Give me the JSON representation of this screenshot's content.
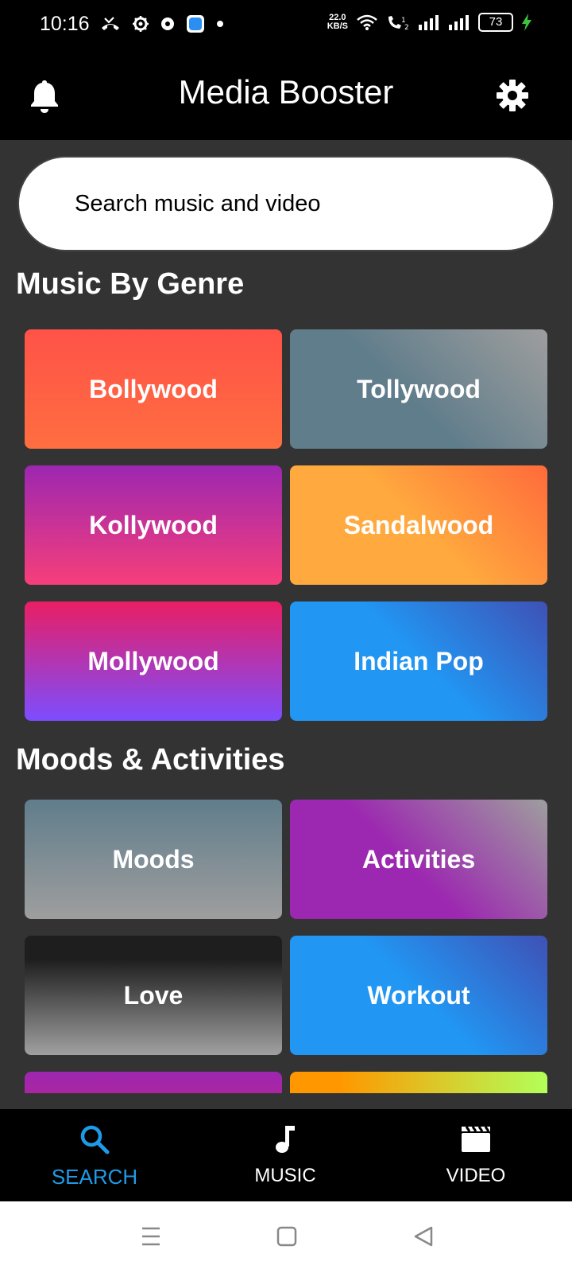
{
  "status_bar": {
    "time": "10:16",
    "net_speed_value": "22.0",
    "net_speed_unit": "KB/S",
    "battery": "73"
  },
  "app_bar": {
    "title": "Media Booster",
    "left_icon": "bell-icon",
    "right_icon": "gear-icon"
  },
  "search": {
    "placeholder": "Search music and video"
  },
  "genre_section": {
    "title": "Music By Genre",
    "tiles": [
      {
        "label": "Bollywood"
      },
      {
        "label": "Tollywood"
      },
      {
        "label": "Kollywood"
      },
      {
        "label": "Sandalwood"
      },
      {
        "label": "Mollywood"
      },
      {
        "label": "Indian Pop"
      }
    ]
  },
  "moods_section": {
    "title": "Moods & Activities",
    "tiles": [
      {
        "label": "Moods"
      },
      {
        "label": "Activities"
      },
      {
        "label": "Love"
      },
      {
        "label": "Workout"
      },
      {
        "label": ""
      },
      {
        "label": ""
      }
    ]
  },
  "bottom_nav": {
    "items": [
      {
        "label": "SEARCH",
        "icon": "search-icon",
        "active": true
      },
      {
        "label": "MUSIC",
        "icon": "music-note-icon",
        "active": false
      },
      {
        "label": "VIDEO",
        "icon": "clapperboard-icon",
        "active": false
      }
    ],
    "active_color": "#1E9BE8"
  },
  "system_nav": {
    "buttons": [
      "menu",
      "home",
      "back"
    ]
  }
}
